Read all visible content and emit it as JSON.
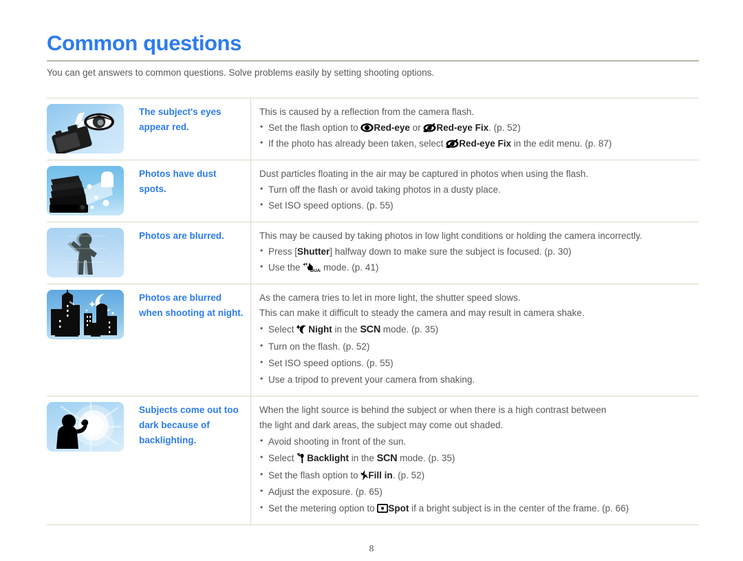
{
  "document": {
    "title": "Common questions",
    "intro": "You can get answers to common questions. Solve problems easily by setting shooting options.",
    "page_number": "8",
    "title_color": "#2d7ced",
    "rule_color": "#7d7f63",
    "body_color": "#58595b"
  },
  "rows": [
    {
      "illustration": "camera-flash-red-eye-illustration",
      "question": "The subject's eyes appear red.",
      "lead": "This is caused by a reflection from the camera flash.",
      "bullets": [
        {
          "segments": [
            {
              "type": "text",
              "value": "Set the flash option to "
            },
            {
              "type": "icon",
              "name": "red-eye-icon"
            },
            {
              "type": "bold",
              "value": "Red-eye"
            },
            {
              "type": "text",
              "value": " or "
            },
            {
              "type": "icon",
              "name": "red-eye-fix-icon"
            },
            {
              "type": "bold",
              "value": "Red-eye Fix"
            },
            {
              "type": "text",
              "value": ". (p. 52)"
            }
          ]
        },
        {
          "segments": [
            {
              "type": "text",
              "value": "If the photo has already been taken, select "
            },
            {
              "type": "icon",
              "name": "red-eye-fix-icon"
            },
            {
              "type": "bold",
              "value": "Red-eye Fix"
            },
            {
              "type": "text",
              "value": " in the edit menu. (p. 87)"
            }
          ]
        }
      ]
    },
    {
      "illustration": "dusty-books-flash-illustration",
      "question": "Photos have dust spots.",
      "lead": "Dust particles floating in the air may be captured in photos when using the flash.",
      "bullets": [
        {
          "segments": [
            {
              "type": "text",
              "value": "Turn off the flash or avoid taking photos in a dusty place."
            }
          ]
        },
        {
          "segments": [
            {
              "type": "text",
              "value": "Set ISO speed options. (p. 55)"
            }
          ]
        }
      ]
    },
    {
      "illustration": "blurred-person-illustration",
      "question": "Photos are blurred.",
      "lead": "This may be caused by taking photos in low light conditions or holding the camera incorrectly.",
      "bullets": [
        {
          "segments": [
            {
              "type": "text",
              "value": "Press ["
            },
            {
              "type": "bold",
              "value": "Shutter"
            },
            {
              "type": "text",
              "value": "] halfway down to make sure the subject is focused. (p. 30)"
            }
          ]
        },
        {
          "segments": [
            {
              "type": "text",
              "value": "Use the "
            },
            {
              "type": "icon",
              "name": "dual-is-icon"
            },
            {
              "type": "text",
              "value": " mode. (p. 41)"
            }
          ]
        }
      ]
    },
    {
      "illustration": "night-city-skyline-illustration",
      "question": "Photos are blurred when shooting at night.",
      "lead": "As the camera tries to let in more light, the shutter speed slows.\nThis can make it difficult to steady the camera and may result in camera shake.",
      "bullets": [
        {
          "segments": [
            {
              "type": "text",
              "value": "Select "
            },
            {
              "type": "icon",
              "name": "night-mode-icon"
            },
            {
              "type": "bold",
              "value": "Night"
            },
            {
              "type": "text",
              "value": " in the "
            },
            {
              "type": "scn",
              "value": "SCN"
            },
            {
              "type": "text",
              "value": " mode. (p. 35)"
            }
          ]
        },
        {
          "segments": [
            {
              "type": "text",
              "value": "Turn on the flash. (p. 52)"
            }
          ]
        },
        {
          "segments": [
            {
              "type": "text",
              "value": "Set ISO speed options. (p. 55)"
            }
          ]
        },
        {
          "segments": [
            {
              "type": "text",
              "value": "Use a tripod to prevent your camera from shaking."
            }
          ]
        }
      ]
    },
    {
      "illustration": "backlit-person-sun-illustration",
      "question": "Subjects come out too dark because of backlighting.",
      "lead": "When the light source is behind the subject or when there is a high contrast between the light and dark areas, the subject may come out shaded.",
      "bullets": [
        {
          "segments": [
            {
              "type": "text",
              "value": "Avoid shooting in front of the sun."
            }
          ]
        },
        {
          "segments": [
            {
              "type": "text",
              "value": "Select "
            },
            {
              "type": "icon",
              "name": "backlight-mode-icon"
            },
            {
              "type": "bold",
              "value": "Backlight"
            },
            {
              "type": "text",
              "value": " in the "
            },
            {
              "type": "scn",
              "value": "SCN"
            },
            {
              "type": "text",
              "value": " mode. (p. 35)"
            }
          ]
        },
        {
          "segments": [
            {
              "type": "text",
              "value": "Set the flash option to "
            },
            {
              "type": "icon",
              "name": "fill-in-flash-icon"
            },
            {
              "type": "bold",
              "value": "Fill in"
            },
            {
              "type": "text",
              "value": ". (p. 52)"
            }
          ]
        },
        {
          "segments": [
            {
              "type": "text",
              "value": "Adjust the exposure. (p. 65)"
            }
          ]
        },
        {
          "segments": [
            {
              "type": "text",
              "value": "Set the metering option to "
            },
            {
              "type": "icon",
              "name": "spot-metering-icon"
            },
            {
              "type": "bold",
              "value": "Spot"
            },
            {
              "type": "text",
              "value": " if a bright subject is in the center of the frame. (p. 66)"
            }
          ]
        }
      ]
    }
  ],
  "row_texts": {
    "r0_q": "The subject's eyes appear red.",
    "r0_lead": "This is caused by a reflection from the camera flash.",
    "r1_q": "Photos have dust spots.",
    "r1_lead": "Dust particles floating in the air may be captured in photos when using the flash.",
    "r1_b0": "Turn off the flash or avoid taking photos in a dusty place.",
    "r1_b1": "Set ISO speed options. (p. 55)",
    "r2_q": "Photos are blurred.",
    "r2_lead": "This may be caused by taking photos in low light conditions or holding the camera incorrectly.",
    "r3_q": "Photos are blurred when shooting at night.",
    "r3_lead1": "As the camera tries to let in more light, the shutter speed slows.",
    "r3_lead2": "This can make it difficult to steady the camera and may result in camera shake.",
    "r3_b1": "Turn on the flash. (p. 52)",
    "r3_b2": "Set ISO speed options. (p. 55)",
    "r3_b3": "Use a tripod to prevent your camera from shaking.",
    "r4_q": "Subjects come out too dark because of backlighting.",
    "r4_lead1": "When the light source is behind the subject or when there is a high contrast between",
    "r4_lead2": "the light and dark areas, the subject may come out shaded.",
    "r4_b0": "Avoid shooting in front of the sun.",
    "r4_b3": "Adjust the exposure. (p. 65)"
  },
  "fragments": {
    "set_flash_option_to": "Set the flash option to ",
    "or": " or ",
    "red_eye": "Red-eye",
    "red_eye_fix": "Red-eye Fix",
    "p52_paren": ". (p. 52)",
    "if_photo_taken": "If the photo has already been taken, select ",
    "in_edit_menu": " in the edit menu. (p. 87)",
    "press_open": "Press [",
    "shutter": "Shutter",
    "halfway": "] halfway down to make sure the subject is focused. (p. 30)",
    "use_the": "Use the ",
    "dual_mode": " mode. (p. 41)",
    "select": "Select ",
    "night": "Night",
    "in_the": " in the ",
    "scn": "SCN",
    "mode_p35": " mode. (p. 35)",
    "backlight": "Backlight",
    "fill_in": "Fill in",
    "set_metering": "Set the metering option to ",
    "spot": "Spot",
    "spot_tail": " if a bright subject is in the center of the frame. (p. 66)"
  }
}
